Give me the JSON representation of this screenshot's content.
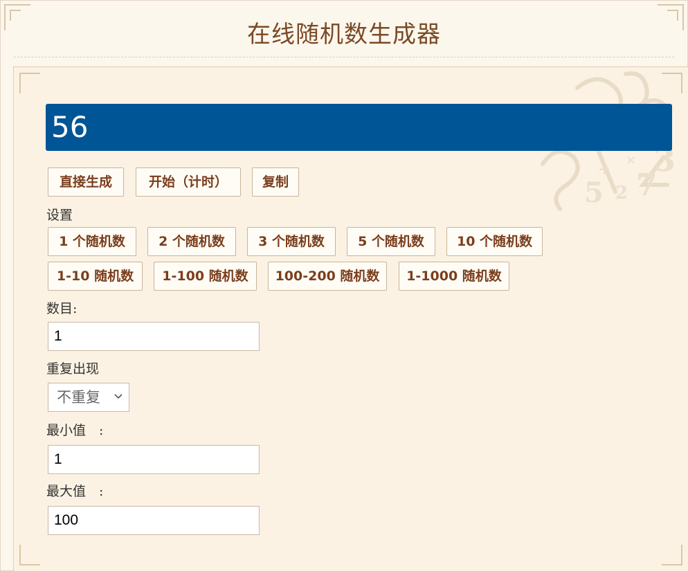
{
  "header": {
    "title": "在线随机数生成器"
  },
  "result": {
    "value": "56"
  },
  "actions": {
    "generate_label": "直接生成",
    "start_timer_label": "开始（计时）",
    "copy_label": "复制"
  },
  "settings": {
    "heading": "设置",
    "count_presets": [
      "1 个随机数",
      "2 个随机数",
      "3 个随机数",
      "5 个随机数",
      "10 个随机数"
    ],
    "range_presets": [
      "1-10 随机数",
      "1-100 随机数",
      "100-200 随机数",
      "1-1000 随机数"
    ]
  },
  "form": {
    "count_label": "数目:",
    "count_value": "1",
    "repeat_label": "重复出现",
    "repeat_selected": "不重复",
    "min_label": "最小值　:",
    "min_value": "1",
    "max_label": "最大值　:",
    "max_value": "100"
  },
  "colors": {
    "title": "#7a4a26",
    "result_bg": "#005596",
    "button_text": "#7a3e1c",
    "page_bg": "#fcf7ec"
  }
}
